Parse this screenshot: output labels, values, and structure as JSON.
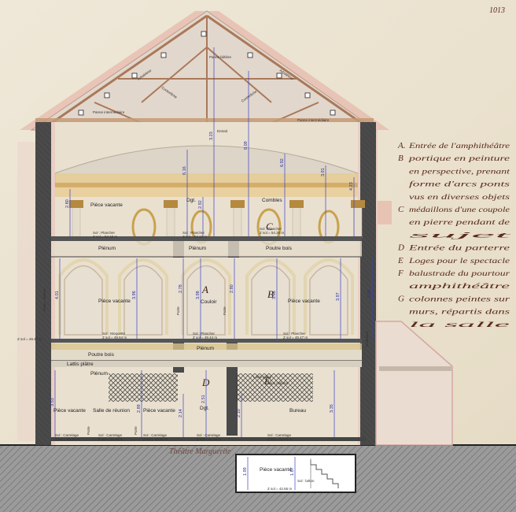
{
  "sheet": {
    "page_number": "1013"
  },
  "colors": {
    "paper": "#eee6d6",
    "ink": "#5a2a1a",
    "dimension": "#3a43c8",
    "wall": "#5b5b5b",
    "ground": "#8a8a8a",
    "roof": "#d9c8b8",
    "timber": "#b07f5a"
  },
  "legend": [
    {
      "letter": "A.",
      "text": "Entrée de l'amphithéâtre"
    },
    {
      "letter": "B",
      "text": "portique en peinture"
    },
    {
      "letter": "",
      "text": "en perspective, prenant"
    },
    {
      "letter": "",
      "text": "forme d'arcs ponts"
    },
    {
      "letter": "",
      "text": "vus en diverses objets"
    },
    {
      "letter": "C",
      "text": "médaillons d'une coupole"
    },
    {
      "letter": "",
      "text": "en pierre pendant de"
    },
    {
      "letter": "",
      "text": "sujet"
    },
    {
      "letter": "D",
      "text": "Entrée du parterre"
    },
    {
      "letter": "E",
      "text": "Loges pour le spectacle"
    },
    {
      "letter": "F",
      "text": "balustrade du pourtour"
    },
    {
      "letter": "",
      "text": "amphithéâtre"
    },
    {
      "letter": "G",
      "text": "colonnes peintes sur"
    },
    {
      "letter": "",
      "text": "murs, répartis dans"
    },
    {
      "letter": "",
      "text": "la salle"
    }
  ],
  "roof_labels": {
    "panne_faitiere": "Panne faîtière",
    "contrefiche_left": "Contrefiche",
    "contrefiche_right": "Contrefiche",
    "arbaletrier_left": "Arbalétrier",
    "arbaletrier_right": "Arbalétrier",
    "panne_left": "Panne intermédiaire",
    "panne_right": "Panne intermédiaire",
    "entrait": "Entrait"
  },
  "rooms": {
    "piece_vacante_upper": "Pièce vacante",
    "dgt_upper": "Dgt.",
    "combles": "Combles",
    "plenum_left": "Plénum",
    "plenum_mid": "Plénum",
    "poutre_bois_upper": "Poutre bois",
    "piece_vacante_mid_left": "Pièce vacante",
    "couloir": "Couloir",
    "porte_1": "Porte",
    "porte_2": "Porte",
    "piece_vacante_mid_right": "Pièce vacante",
    "poutre_bois_lower": "Poutre bois",
    "plenum_lower": "Plénum",
    "lattis_platre": "Lattis plâtre",
    "plenum_ground": "Plénum",
    "lattis_platre_right": "Lattis plâtre",
    "faux_plafond": "Faux plafond",
    "piece_vacante_ground_left": "Pièce vacante",
    "salle_reunion": "Salle de réunion",
    "piece_vacante_ground_mid": "Pièce vacante",
    "dgt_ground": "Dgt.",
    "bureau": "Bureau",
    "porte_ground_1": "Porte",
    "porte_ground_2": "Porte",
    "porte_fenetre": "Porte - fenêtre",
    "radiateur": "Radiateur",
    "piece_vacante_basement": "Pièce vacante"
  },
  "levels": {
    "plancher_upper_1": "Sol : Plancher",
    "z_upper_1": "Z sol = 54.10 m",
    "plancher_upper_2": "Sol : Plancher",
    "z_upper_2": "Z sol = 54.12 m",
    "plancher_upper_3": "Sol : Plancher",
    "z_upper_3": "Z sol = 54.30 m",
    "moquette_mid_1": "Sol : Moquette",
    "z_mid_1": "Z sol = 49.64 m",
    "plancher_mid_2": "Sol : Plancher",
    "z_mid_2": "Z sol = 49.44 m",
    "plancher_mid_3": "Sol : Plancher",
    "z_mid_3": "Z sol = 49.47 m",
    "z_mid_left": "Z sol = 49.47 m",
    "carrelage_g1": "Sol : Carrelage",
    "z_g1": "Z sol = 44.94 m",
    "carrelage_g2": "Sol : Carrelage",
    "z_g2": "Z sol = 44.94 m",
    "carrelage_g3": "Sol : Carrelage",
    "z_g3": "Z sol = 44.94 m",
    "carrelage_g4": "Sol : Carrelage",
    "z_g4": "Z sol = 44.98 m",
    "carrelage_g5": "Sol : Carrelage",
    "z_g5": "Z sol = 44.93 m",
    "beton_basement": "Sol : béton",
    "z_basement": "Z sol = 42.65 m"
  },
  "dimensions": {
    "roof_1": "3.23",
    "roof_2": "8.09",
    "upper_1": "2.80",
    "upper_2": "6.16",
    "upper_3": "2.92",
    "upper_4": "6.92",
    "upper_5": "3.91",
    "upper_6": "4.23",
    "mid_1": "4.01",
    "mid_2": "3.96",
    "mid_3": "2.78",
    "mid_4": "3.98",
    "mid_5": "2.80",
    "mid_6": "3.96",
    "mid_7": "3.97",
    "mid_8": "3.87",
    "ground_1": "3.53",
    "ground_2": "2.89",
    "ground_3": "2.14",
    "ground_4": "2.51",
    "ground_5": "2.10",
    "ground_6": "3.35",
    "basement_1": "1.99",
    "basement_2": "1.87"
  },
  "plan_letters": {
    "a": "A",
    "b": "B",
    "c": "C",
    "d": "D",
    "e": "E"
  },
  "ground_note": "Théâtre Marguerite"
}
